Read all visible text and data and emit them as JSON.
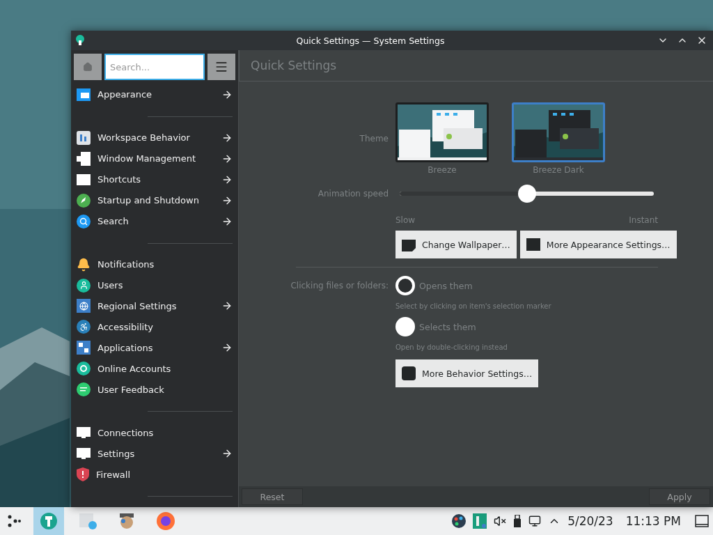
{
  "window": {
    "title": "Quick Settings — System Settings"
  },
  "sidebar": {
    "search": {
      "placeholder": "Search..."
    },
    "groups": [
      [
        {
          "label": "Appearance",
          "arrow": true
        }
      ],
      [
        {
          "label": "Workspace Behavior",
          "arrow": true
        },
        {
          "label": "Window Management",
          "arrow": true
        },
        {
          "label": "Shortcuts",
          "arrow": true
        },
        {
          "label": "Startup and Shutdown",
          "arrow": true
        },
        {
          "label": "Search",
          "arrow": true
        }
      ],
      [
        {
          "label": "Notifications",
          "arrow": false
        },
        {
          "label": "Users",
          "arrow": false
        },
        {
          "label": "Regional Settings",
          "arrow": true
        },
        {
          "label": "Accessibility",
          "arrow": false
        },
        {
          "label": "Applications",
          "arrow": true
        },
        {
          "label": "Online Accounts",
          "arrow": false
        },
        {
          "label": "User Feedback",
          "arrow": false
        }
      ],
      [
        {
          "label": "Connections",
          "arrow": false
        },
        {
          "label": "Settings",
          "arrow": true
        },
        {
          "label": "Firewall",
          "arrow": false
        }
      ]
    ]
  },
  "page": {
    "title": "Quick Settings",
    "theme_label": "Theme",
    "themes": [
      {
        "label": "Breeze",
        "selected": false,
        "kind": "light"
      },
      {
        "label": "Breeze Dark",
        "selected": true,
        "kind": "dark"
      }
    ],
    "animation": {
      "label": "Animation speed",
      "level": 0.5,
      "min_label": "Slow",
      "max_label": "Instant"
    },
    "appearance_buttons": [
      "Change Wallpaper…",
      "More Appearance Settings…"
    ],
    "clicking": {
      "label": "Clicking files or folders:",
      "options": [
        {
          "label": "Opens them",
          "hint": "Select by clicking on item's selection marker",
          "selected": true
        },
        {
          "label": "Selects them",
          "hint": "Open by double-clicking instead",
          "selected": false
        }
      ]
    },
    "behavior_button": "More Behavior Settings…"
  },
  "footer": {
    "reset": "Reset",
    "apply": "Apply"
  },
  "taskbar": {
    "date": "5/20/23",
    "time": "11:13 PM"
  }
}
